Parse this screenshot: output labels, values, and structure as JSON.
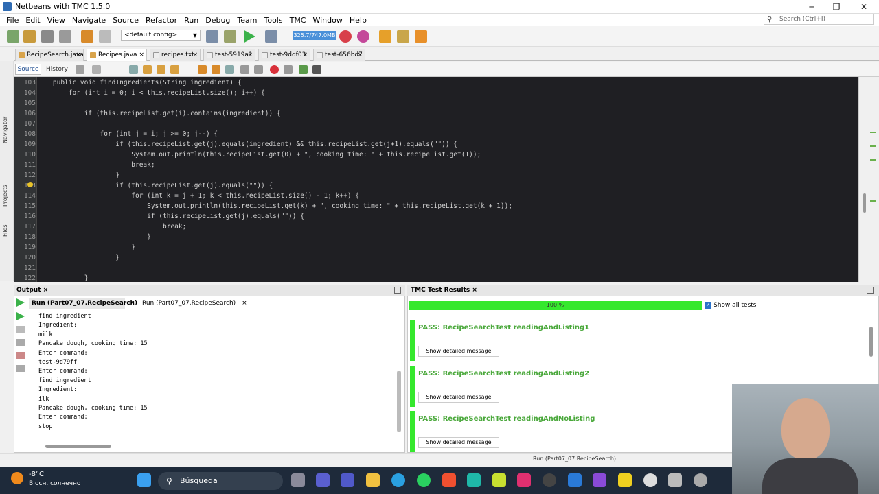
{
  "window": {
    "title": "Netbeans with TMC 1.5.0"
  },
  "menu": [
    "File",
    "Edit",
    "View",
    "Navigate",
    "Source",
    "Refactor",
    "Run",
    "Debug",
    "Team",
    "Tools",
    "TMC",
    "Window",
    "Help"
  ],
  "search": {
    "placeholder": "Search (Ctrl+I)"
  },
  "toolbar": {
    "config": "<default config>",
    "memory": "325.7/747.0MB"
  },
  "tabs": [
    "RecipeSearch.java",
    "Recipes.java",
    "recipes.txt",
    "test-5919a1",
    "test-9ddf03",
    "test-656bd7"
  ],
  "editor": {
    "source_label": "Source",
    "history_label": "History",
    "line_numbers": [
      "103",
      "104",
      "105",
      "106",
      "107",
      "108",
      "109",
      "110",
      "111",
      "112",
      "113",
      "114",
      "115",
      "116",
      "117",
      "118",
      "119",
      "120",
      "121",
      "122"
    ],
    "code_lines": [
      "    public void findIngredients(String ingredient) {",
      "        for (int i = 0; i < this.recipeList.size(); i++) {",
      "",
      "            if (this.recipeList.get(i).contains(ingredient)) {",
      "",
      "                for (int j = i; j >= 0; j--) {",
      "                    if (this.recipeList.get(j).equals(ingredient) && this.recipeList.get(j+1).equals(\"\")) {",
      "                        System.out.println(this.recipeList.get(0) + \", cooking time: \" + this.recipeList.get(1));",
      "                        break;",
      "                    }",
      "                    if (this.recipeList.get(j).equals(\"\")) {",
      "                        for (int k = j + 1; k < this.recipeList.size() - 1; k++) {",
      "                            System.out.println(this.recipeList.get(k) + \", cooking time: \" + this.recipeList.get(k + 1));",
      "                            if (this.recipeList.get(j).equals(\"\")) {",
      "                                break;",
      "                            }",
      "                        }",
      "                    }",
      "",
      "            }"
    ]
  },
  "output": {
    "panel_title": "Output",
    "tab_active": "Run (Part07_07.RecipeSearch)",
    "tab_second": "Run (Part07_07.RecipeSearch)",
    "lines": [
      "find ingredient",
      "Ingredient:",
      "milk",
      "Pancake dough, cooking time: 15",
      "Enter command:",
      "test-9d79ff",
      "Enter command:",
      "find ingredient",
      "Ingredient:",
      "ilk",
      "Pancake dough, cooking time: 15",
      "Enter command:",
      "stop"
    ]
  },
  "tmc": {
    "panel_title": "TMC Test Results",
    "progress": "100 %",
    "progress_value": 1.0,
    "show_all": "Show all tests",
    "results": [
      {
        "title": "PASS: RecipeSearchTest readingAndListing1",
        "button": "Show detailed message"
      },
      {
        "title": "PASS: RecipeSearchTest readingAndListing2",
        "button": "Show detailed message"
      },
      {
        "title": "PASS: RecipeSearchTest readingAndNoListing",
        "button": "Show detailed message"
      }
    ],
    "pass_color": "#35e82d"
  },
  "status": {
    "text": "Run (Part07_07.RecipeSearch)"
  },
  "taskbar": {
    "temperature": "-8°C",
    "weather": "В осн. солнечно",
    "search": "Búsqueda"
  }
}
